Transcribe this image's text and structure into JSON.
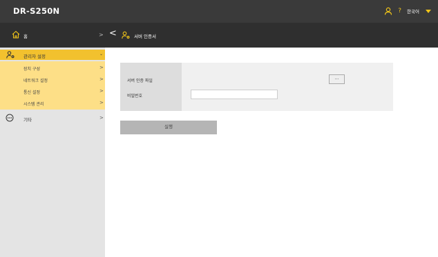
{
  "app": {
    "title": "DR-S250N"
  },
  "header": {
    "help": "?",
    "language": "한국어"
  },
  "nav": {
    "home": "홈",
    "separator": ">",
    "back": "<",
    "page_title": "서버 인증서"
  },
  "sidebar": {
    "admin": {
      "label": "관리자 설정",
      "arrow": "⌄"
    },
    "items": [
      {
        "label": "장치 구성",
        "arrow": ">"
      },
      {
        "label": "네트워크 설정",
        "arrow": ">"
      },
      {
        "label": "통신 설정",
        "arrow": ">"
      },
      {
        "label": "시스템 관리",
        "arrow": ">"
      }
    ],
    "etc": {
      "label": "기타",
      "arrow": ">"
    }
  },
  "form": {
    "file_label": "서버 인증 파일",
    "file_button": "...",
    "password_label": "비밀번호",
    "password_value": "",
    "submit": "실행"
  },
  "colors": {
    "accent": "#f2c12e",
    "accent_light": "#fddf87",
    "header": "#3a3a3a",
    "navbar": "#2f2f2f"
  }
}
